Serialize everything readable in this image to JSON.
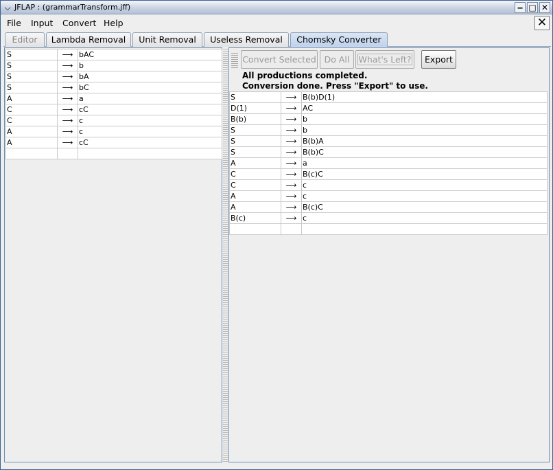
{
  "window": {
    "title": "JFLAP : (grammarTransform.jff)"
  },
  "menubar": {
    "items": [
      "File",
      "Input",
      "Convert",
      "Help"
    ]
  },
  "tabs": [
    "Editor",
    "Lambda Removal",
    "Unit Removal",
    "Useless Removal",
    "Chomsky Converter"
  ],
  "arrow_glyph": "⟶",
  "left_grammar": [
    {
      "lhs": "S",
      "rhs": "bAC"
    },
    {
      "lhs": "S",
      "rhs": "b"
    },
    {
      "lhs": "S",
      "rhs": "bA"
    },
    {
      "lhs": "S",
      "rhs": "bC"
    },
    {
      "lhs": "A",
      "rhs": "a"
    },
    {
      "lhs": "C",
      "rhs": "cC"
    },
    {
      "lhs": "C",
      "rhs": "c"
    },
    {
      "lhs": "A",
      "rhs": "c"
    },
    {
      "lhs": "A",
      "rhs": "cC"
    }
  ],
  "toolbar": {
    "convert_selected": "Convert Selected",
    "do_all": "Do All",
    "whats_left": "What's Left?",
    "export": "Export"
  },
  "status": {
    "line1": "All productions completed.",
    "line2": "Conversion done.  Press \"Export\" to use."
  },
  "right_grammar": [
    {
      "lhs": "S",
      "rhs": "B(b)D(1)"
    },
    {
      "lhs": "D(1)",
      "rhs": "AC"
    },
    {
      "lhs": "B(b)",
      "rhs": "b"
    },
    {
      "lhs": "S",
      "rhs": "b"
    },
    {
      "lhs": "S",
      "rhs": "B(b)A"
    },
    {
      "lhs": "S",
      "rhs": "B(b)C"
    },
    {
      "lhs": "A",
      "rhs": "a"
    },
    {
      "lhs": "C",
      "rhs": "B(c)C"
    },
    {
      "lhs": "C",
      "rhs": "c"
    },
    {
      "lhs": "A",
      "rhs": "c"
    },
    {
      "lhs": "A",
      "rhs": "B(c)C"
    },
    {
      "lhs": "B(c)",
      "rhs": "c"
    }
  ]
}
